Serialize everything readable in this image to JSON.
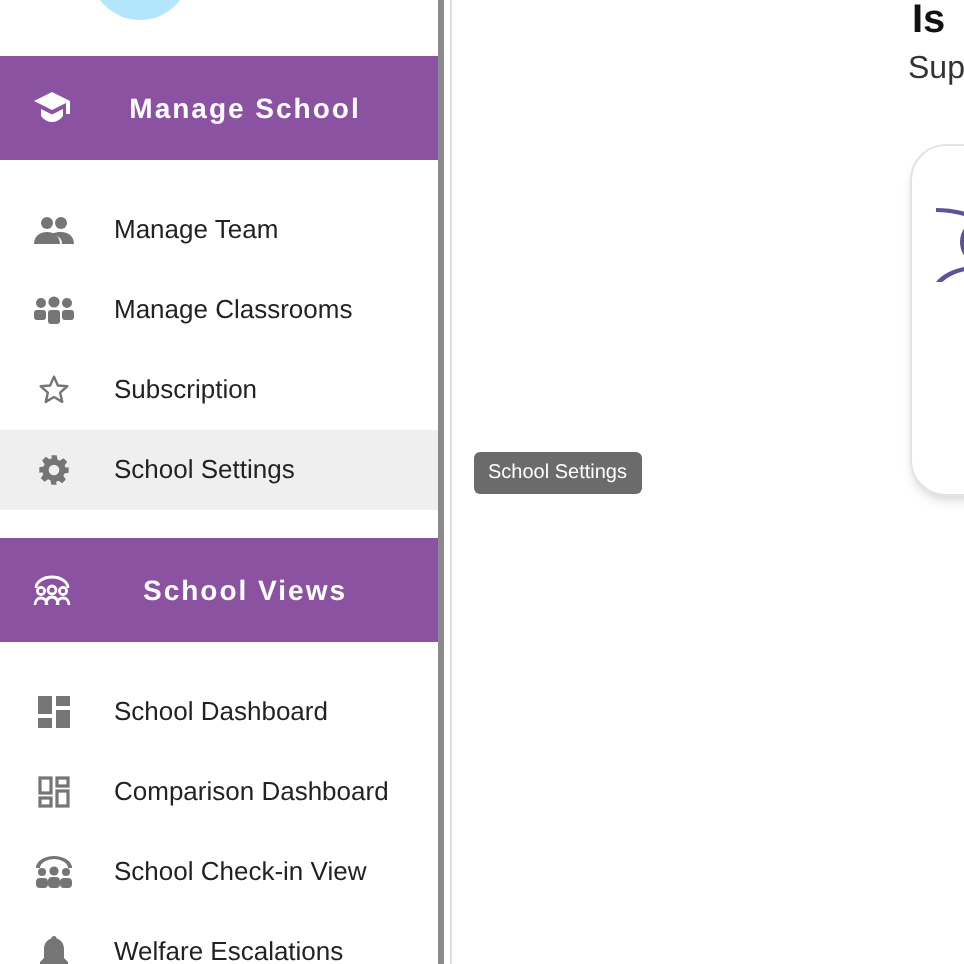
{
  "sidebar": {
    "sections": [
      {
        "title": "Manage School",
        "items": [
          {
            "label": "Manage Team",
            "selected": false
          },
          {
            "label": "Manage Classrooms",
            "selected": false
          },
          {
            "label": "Subscription",
            "selected": false
          },
          {
            "label": "School Settings",
            "selected": true
          }
        ]
      },
      {
        "title": "School Views",
        "items": [
          {
            "label": "School Dashboard",
            "selected": false
          },
          {
            "label": "Comparison Dashboard",
            "selected": false
          },
          {
            "label": "School Check-in View",
            "selected": false
          },
          {
            "label": "Welfare Escalations",
            "selected": false
          }
        ]
      }
    ]
  },
  "tooltip": "School Settings",
  "main": {
    "title": "Is",
    "subtitle": "Sup"
  }
}
